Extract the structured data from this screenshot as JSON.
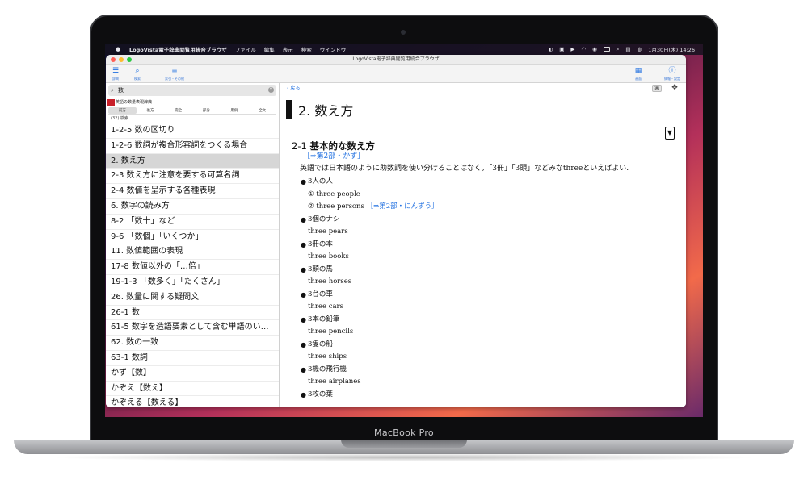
{
  "device": {
    "label": "MacBook Pro"
  },
  "menubar": {
    "app_name": "LogoVista電子辞典閲覧用統合ブラウザ",
    "menus": [
      "ファイル",
      "編集",
      "表示",
      "検索",
      "ウインドウ"
    ],
    "clock": "1月30日(木)  14:26"
  },
  "window": {
    "title": "LogoVista電子辞典閲覧用統合ブラウザ",
    "toolbar": {
      "left": [
        {
          "label": "辞典"
        },
        {
          "label": "検索"
        },
        {
          "label": "索引・その他"
        }
      ],
      "right": [
        {
          "label": "画面"
        },
        {
          "label": "情報・設定"
        }
      ]
    }
  },
  "sidebar": {
    "search_value": "数",
    "dictionary": "英語の数量表現辞典",
    "modes": [
      {
        "label": "前方",
        "selected": true
      },
      {
        "label": "後方",
        "selected": false
      },
      {
        "label": "完全",
        "selected": false
      },
      {
        "label": "部分",
        "selected": false
      },
      {
        "label": "用例",
        "selected": false
      },
      {
        "label": "全文",
        "selected": false
      }
    ],
    "result_count": "(32) 検索",
    "items": [
      {
        "label": "1-2-5 数の区切り"
      },
      {
        "label": "1-2-6 数詞が複合形容詞をつくる場合"
      },
      {
        "label": "2. 数え方",
        "selected": true
      },
      {
        "label": "2-3 数え方に注意を要する可算名詞"
      },
      {
        "label": "2-4 数値を呈示する各種表現"
      },
      {
        "label": "6. 数字の読み方"
      },
      {
        "label": "8-2 「数十」など"
      },
      {
        "label": "9-6 「数個」「いくつか」"
      },
      {
        "label": "11. 数値範囲の表現"
      },
      {
        "label": "17-8 数値以外の「…倍」"
      },
      {
        "label": "19-1-3 「数多く」「たくさん」"
      },
      {
        "label": "26. 数量に関する疑問文"
      },
      {
        "label": "26-1 数"
      },
      {
        "label": "61-5 数字を造語要素として含む単語のい…"
      },
      {
        "label": "62. 数の一致"
      },
      {
        "label": "63-1 数詞"
      },
      {
        "label": "かず【数】"
      },
      {
        "label": "かぞえ【数え】"
      },
      {
        "label": "かぞえる【数える】"
      }
    ]
  },
  "content": {
    "back_label": "戻る",
    "title": "2. 数え方",
    "collapse_glyph": "▼",
    "section_number": "2-1",
    "section_title": "基本的な数え方",
    "ref_open": "［⇒",
    "ref1_link": "第2部・かず",
    "ref_close": "］",
    "paragraph": "英語では日本語のように助数詞を使い分けることはなく，「3冊」「3頭」などみなthreeといえばよい.",
    "bullet1_head": "3人の人",
    "bullet1_sub1": "① three people",
    "bullet1_sub2": "② three persons",
    "ref2_link": "第2部・にんずう",
    "bullets": [
      {
        "jp": "3個のナシ",
        "en": "three pears"
      },
      {
        "jp": "3冊の本",
        "en": "three books"
      },
      {
        "jp": "3頭の馬",
        "en": "three horses"
      },
      {
        "jp": "3台の車",
        "en": "three cars"
      },
      {
        "jp": "3本の鉛筆",
        "en": "three pencils"
      },
      {
        "jp": "3隻の船",
        "en": "three ships"
      },
      {
        "jp": "3機の飛行機",
        "en": "three airplanes"
      },
      {
        "jp": "3枚の葉",
        "en": ""
      }
    ]
  },
  "colors": {
    "accent": "#1f6fe0",
    "selection": "#d6d6d6",
    "dictionary_icon": "#c8202a"
  }
}
